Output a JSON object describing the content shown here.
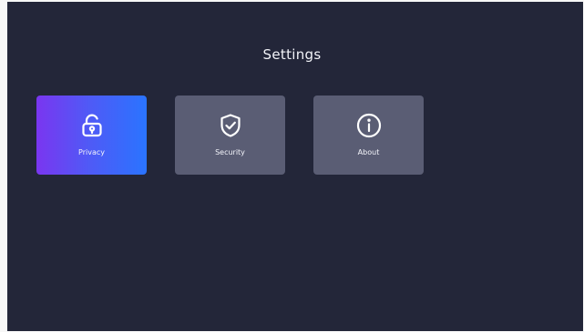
{
  "page": {
    "title": "Settings"
  },
  "tiles": [
    {
      "label": "Privacy",
      "icon": "unlock-icon",
      "active": true
    },
    {
      "label": "Security",
      "icon": "shield-check-icon",
      "active": false
    },
    {
      "label": "About",
      "icon": "info-icon",
      "active": false
    }
  ],
  "colors": {
    "background": "#232639",
    "tile": "#5a5d74",
    "active_gradient_start": "#7a36f0",
    "active_gradient_end": "#2a74ff",
    "text": "#f2f3f8"
  }
}
